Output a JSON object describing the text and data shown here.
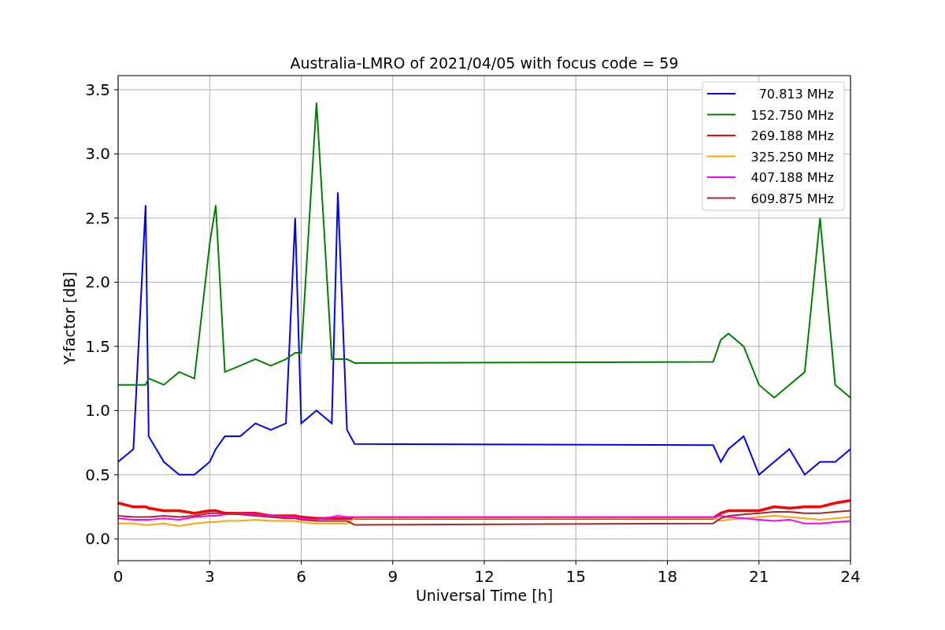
{
  "figure": {
    "chart_data": {
      "type": "line",
      "title": "Australia-LMRO of 2021/04/05 with focus code = 59",
      "xlabel": "Universal Time [h]",
      "ylabel": "Y-factor [dB]",
      "x": [
        0,
        0.5,
        0.9,
        1,
        1.5,
        2,
        2.5,
        3,
        3.2,
        3.5,
        4,
        4.5,
        5,
        5.5,
        5.8,
        6,
        6.5,
        7,
        7.2,
        7.5,
        7.75,
        19.5,
        19.75,
        20,
        20.5,
        21,
        21.5,
        22,
        22.5,
        23,
        23.5,
        24
      ],
      "series": [
        {
          "name": "70.813 MHz",
          "color": "#0000ff",
          "values": [
            0.6,
            0.7,
            2.6,
            0.8,
            0.6,
            0.5,
            0.5,
            0.6,
            0.7,
            0.8,
            0.8,
            0.9,
            0.85,
            0.9,
            2.5,
            0.9,
            1.0,
            0.9,
            2.7,
            0.85,
            0.74,
            0.73,
            0.6,
            0.7,
            0.8,
            0.5,
            0.6,
            0.7,
            0.5,
            0.6,
            0.6,
            0.7
          ]
        },
        {
          "name": "152.750 MHz",
          "color": "#008000",
          "values": [
            1.2,
            1.2,
            1.2,
            1.25,
            1.2,
            1.3,
            1.25,
            2.3,
            2.6,
            1.3,
            1.35,
            1.4,
            1.35,
            1.4,
            1.45,
            1.45,
            3.4,
            1.4,
            1.4,
            1.4,
            1.37,
            1.38,
            1.55,
            1.6,
            1.5,
            1.2,
            1.1,
            1.2,
            1.3,
            2.5,
            1.2,
            1.1
          ]
        },
        {
          "name": "269.188 MHz",
          "color": "#ff0000",
          "values": [
            0.28,
            0.25,
            0.25,
            0.24,
            0.22,
            0.22,
            0.2,
            0.22,
            0.22,
            0.2,
            0.2,
            0.2,
            0.18,
            0.18,
            0.18,
            0.17,
            0.16,
            0.16,
            0.16,
            0.16,
            0.16,
            0.16,
            0.2,
            0.22,
            0.22,
            0.22,
            0.25,
            0.24,
            0.25,
            0.25,
            0.28,
            0.3
          ]
        },
        {
          "name": "325.250 MHz",
          "color": "#ffa500",
          "values": [
            0.12,
            0.12,
            0.11,
            0.11,
            0.12,
            0.1,
            0.12,
            0.13,
            0.13,
            0.14,
            0.14,
            0.15,
            0.14,
            0.14,
            0.14,
            0.13,
            0.12,
            0.12,
            0.12,
            0.12,
            0.16,
            0.16,
            0.14,
            0.15,
            0.16,
            0.17,
            0.18,
            0.17,
            0.16,
            0.15,
            0.16,
            0.17
          ]
        },
        {
          "name": "407.188 MHz",
          "color": "#ff00ff",
          "values": [
            0.16,
            0.15,
            0.15,
            0.15,
            0.16,
            0.15,
            0.17,
            0.18,
            0.18,
            0.19,
            0.2,
            0.19,
            0.18,
            0.17,
            0.17,
            0.16,
            0.15,
            0.17,
            0.18,
            0.17,
            0.17,
            0.17,
            0.18,
            0.17,
            0.16,
            0.15,
            0.14,
            0.15,
            0.12,
            0.12,
            0.13,
            0.14
          ]
        },
        {
          "name": "609.875 MHz",
          "color": "#a52a2a",
          "values": [
            0.18,
            0.17,
            0.17,
            0.17,
            0.18,
            0.17,
            0.18,
            0.2,
            0.2,
            0.2,
            0.19,
            0.18,
            0.17,
            0.16,
            0.16,
            0.15,
            0.14,
            0.14,
            0.14,
            0.14,
            0.11,
            0.12,
            0.16,
            0.18,
            0.19,
            0.2,
            0.21,
            0.21,
            0.2,
            0.2,
            0.21,
            0.22
          ]
        }
      ],
      "xlim": [
        0,
        24
      ],
      "ylim": [
        -0.17,
        3.61
      ],
      "grid": true,
      "legend": true,
      "xticks": [
        0,
        3,
        6,
        9,
        12,
        15,
        18,
        21,
        24
      ],
      "yticks": [
        {
          "value": 0,
          "label": "0.0"
        },
        {
          "value": 0.5,
          "label": "0.5"
        },
        {
          "value": 1,
          "label": "1.0"
        },
        {
          "value": 1.5,
          "label": "1.5"
        },
        {
          "value": 2,
          "label": "2.0"
        },
        {
          "value": 2.5,
          "label": "2.5"
        },
        {
          "value": 3,
          "label": "3.0"
        },
        {
          "value": 3.5,
          "label": "3.5"
        }
      ]
    }
  }
}
